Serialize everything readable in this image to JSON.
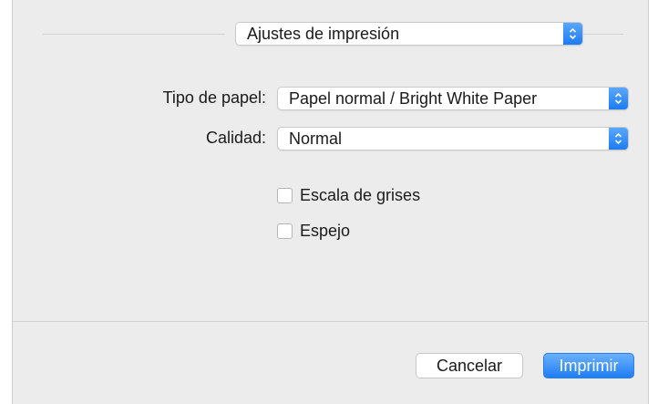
{
  "header": {
    "preset_popup": "Ajustes de impresión"
  },
  "settings": {
    "paper_type_label": "Tipo de papel:",
    "paper_type_value": "Papel normal / Bright White Paper",
    "quality_label": "Calidad:",
    "quality_value": "Normal"
  },
  "options": {
    "grayscale_label": "Escala de grises",
    "grayscale_checked": false,
    "mirror_label": "Espejo",
    "mirror_checked": false
  },
  "footer": {
    "cancel_label": "Cancelar",
    "print_label": "Imprimir"
  },
  "colors": {
    "accent": "#1f7ef3"
  }
}
